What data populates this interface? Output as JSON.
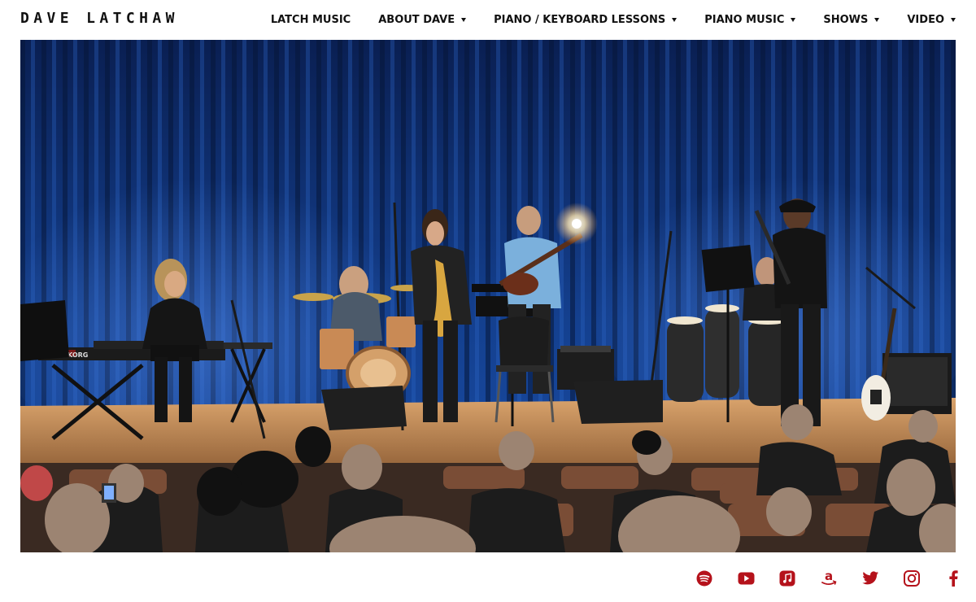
{
  "site": {
    "title": "DAVE LATCHAW"
  },
  "nav": {
    "items": [
      {
        "label": "LATCH MUSIC",
        "dropdown": false
      },
      {
        "label": "ABOUT DAVE",
        "dropdown": true
      },
      {
        "label": "PIANO / KEYBOARD LESSONS",
        "dropdown": true
      },
      {
        "label": "PIANO MUSIC",
        "dropdown": true
      },
      {
        "label": "SHOWS",
        "dropdown": true
      },
      {
        "label": "VIDEO",
        "dropdown": true
      }
    ]
  },
  "hero": {
    "image_icon": "band-on-stage-photo",
    "keyboard_brand": "KORG"
  },
  "social": {
    "accent_color": "#b5121b",
    "icons": [
      "spotify-icon",
      "youtube-icon",
      "apple-music-icon",
      "amazon-icon",
      "twitter-icon",
      "instagram-icon",
      "facebook-icon"
    ]
  },
  "colors": {
    "text": "#111111",
    "accent": "#b5121b",
    "curtain": "#0d2a66",
    "stage": "#c48d57"
  }
}
